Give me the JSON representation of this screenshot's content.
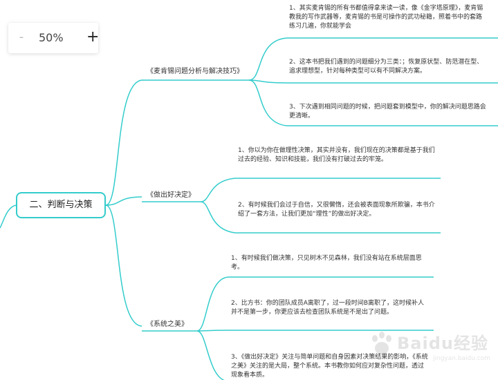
{
  "zoom": {
    "minus": "-",
    "level": "50%",
    "plus": "+"
  },
  "root": {
    "label": "二、判断与决策"
  },
  "branches": [
    {
      "label": "《麦肯锡问题分析与解决技巧》",
      "leaves": [
        "1、其实麦肯锡的所有书都值得拿来读一读，像《金字塔原理》，麦肯锡教我的写作武器等，麦肯锡的书是可操作的武功秘籍，照着书中的套路练习几遍，你就能学会",
        "2、这本书把我们遇到的问题细分为三类：；恢复原状型、防范潜在型、追求理想型，针对每种类型可以有不同解决方案。",
        "3、下次遇到相同问题的时候，把问题套到模型中，你的解决问题思路会更清晰。"
      ]
    },
    {
      "label": "《做出好决定》",
      "leaves": [
        "1、你以为你在做理性决策，其实并没有，我们现在的决策都是基于我们过去的经验、知识和技能，我们没有打破过去的牢笼。",
        "2、有时候我们会过于自信，又很懒惰，还会被表面现象所欺骗，本书介绍了一套方法，让我们更加“理性”的做出好决定。"
      ]
    },
    {
      "label": "《系统之美》",
      "leaves": [
        "1、有时候我们做决策，只见树木不见森林，我们没有站在系统层面思考。",
        "2、比方书：你的团队成员A离职了，过一段时间B离职了，这时候补人并不是第一步，你更应该去检查团队系统是不是出了问题。",
        "3、《做出好决定》关注与简单问题和自身因素对决策结果的影响，《系统之美》关注的是大局，整个系统。本书教你如何应对复杂性问题，透过现象看本质。"
      ]
    }
  ],
  "watermark": {
    "brand": "Baidu经验",
    "url": "jingyan.baidu.com"
  },
  "colors": {
    "line": "#33cccc",
    "root_border": "#33cccc",
    "text": "#333333"
  }
}
